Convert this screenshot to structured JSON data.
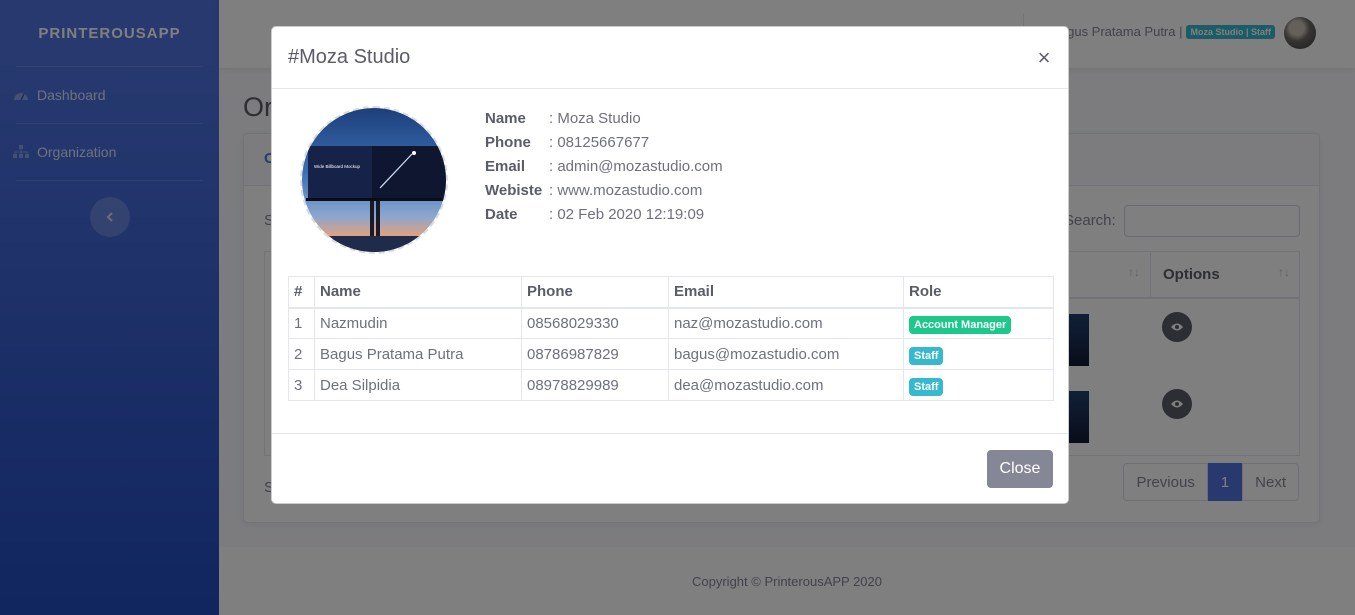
{
  "sidebar": {
    "brand": "PRINTEROUSAPP",
    "items": [
      {
        "label": "Dashboard",
        "icon": "tachometer-icon"
      },
      {
        "label": "Organization",
        "icon": "sitemap-icon"
      }
    ]
  },
  "topbar": {
    "user_name": "Bagus Pratama Putra |",
    "user_badge": "Moza Studio | Staff"
  },
  "page": {
    "title": "Or",
    "card_header": "O",
    "search_label": "Search:",
    "options_header": "Options",
    "show_text": "S",
    "showing_text": "S",
    "pagination": {
      "previous": "Previous",
      "current": "1",
      "next": "Next"
    }
  },
  "footer": {
    "copyright": "Copyright © PrinterousAPP 2020"
  },
  "modal": {
    "title": "#Moza Studio",
    "close_symbol": "×",
    "billboard_title": "Wide Billboard Mockup",
    "details": [
      {
        "label": "Name",
        "value": ": Moza Studio"
      },
      {
        "label": "Phone",
        "value": ": 08125667677"
      },
      {
        "label": "Email",
        "value": ": admin@mozastudio.com"
      },
      {
        "label": "Webiste",
        "value": ": www.mozastudio.com"
      },
      {
        "label": "Date",
        "value": ": 02 Feb 2020 12:19:09"
      }
    ],
    "table": {
      "headers": [
        "#",
        "Name",
        "Phone",
        "Email",
        "Role"
      ],
      "rows": [
        {
          "no": "1",
          "name": "Nazmudin",
          "phone": "08568029330",
          "email": "naz@mozastudio.com",
          "role": "Account Manager",
          "role_color": "#1cc88a"
        },
        {
          "no": "2",
          "name": "Bagus Pratama Putra",
          "phone": "08786987829",
          "email": "bagus@mozastudio.com",
          "role": "Staff",
          "role_color": "#36b9cc"
        },
        {
          "no": "3",
          "name": "Dea Silpidia",
          "phone": "08978829989",
          "email": "dea@mozastudio.com",
          "role": "Staff",
          "role_color": "#36b9cc"
        }
      ]
    },
    "close_label": "Close"
  }
}
